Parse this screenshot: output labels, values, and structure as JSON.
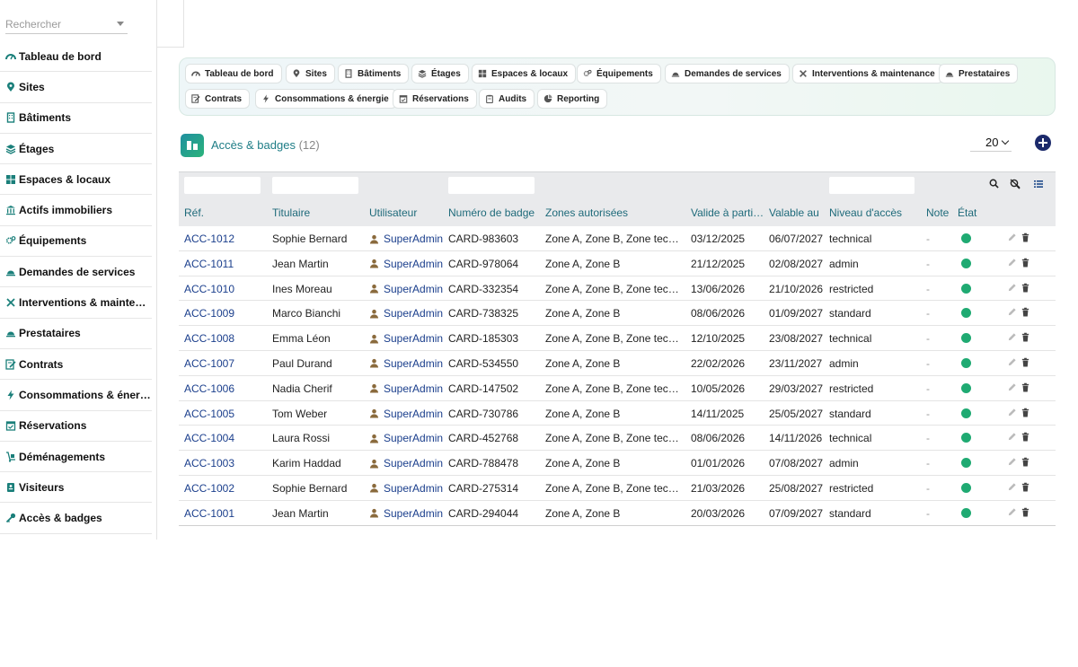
{
  "search": {
    "placeholder": "Rechercher"
  },
  "sidebar": {
    "items": [
      {
        "label": "Tableau de bord",
        "icon": "dashboard-icon"
      },
      {
        "label": "Sites",
        "icon": "map-pin-icon"
      },
      {
        "label": "Bâtiments",
        "icon": "building-icon"
      },
      {
        "label": "Étages",
        "icon": "layers-icon"
      },
      {
        "label": "Espaces & locaux",
        "icon": "grid-icon"
      },
      {
        "label": "Actifs immobiliers",
        "icon": "bank-icon"
      },
      {
        "label": "Équipements",
        "icon": "gears-icon"
      },
      {
        "label": "Demandes de services",
        "icon": "service-bell-icon"
      },
      {
        "label": "Interventions & maintenance",
        "icon": "tools-icon"
      },
      {
        "label": "Prestataires",
        "icon": "service-bell-icon"
      },
      {
        "label": "Contrats",
        "icon": "contract-icon"
      },
      {
        "label": "Consommations & énergie",
        "icon": "bolt-icon"
      },
      {
        "label": "Réservations",
        "icon": "calendar-check-icon"
      },
      {
        "label": "Déménagements",
        "icon": "dolly-icon"
      },
      {
        "label": "Visiteurs",
        "icon": "id-card-icon"
      },
      {
        "label": "Accès & badges",
        "icon": "key-icon"
      }
    ]
  },
  "modules": {
    "row1": [
      {
        "label": "Tableau de bord",
        "icon": "dashboard-icon"
      },
      {
        "label": "Sites",
        "icon": "map-pin-icon"
      },
      {
        "label": "Bâtiments",
        "icon": "building-icon"
      },
      {
        "label": "Étages",
        "icon": "layers-icon"
      },
      {
        "label": "Espaces & locaux",
        "icon": "grid-icon"
      },
      {
        "label": "Équipements",
        "icon": "gears-icon"
      },
      {
        "label": "Demandes de services",
        "icon": "service-bell-icon"
      },
      {
        "label": "Interventions & maintenance",
        "icon": "tools-icon"
      },
      {
        "label": "Prestataires",
        "icon": "service-bell-icon"
      }
    ],
    "row2": [
      {
        "label": "Contrats",
        "icon": "contract-icon"
      },
      {
        "label": "Consommations & énergie",
        "icon": "bolt-icon"
      },
      {
        "label": "Réservations",
        "icon": "calendar-check-icon"
      },
      {
        "label": "Audits",
        "icon": "clipboard-icon"
      },
      {
        "label": "Reporting",
        "icon": "pie-chart-icon"
      }
    ]
  },
  "page": {
    "title": "Accès & badges",
    "count": "(12)",
    "per_page": "20"
  },
  "table": {
    "columns": [
      "Réf.",
      "Titulaire",
      "Utilisateur",
      "Numéro de badge",
      "Zones autorisées",
      "Valide à partir du",
      "Valable au",
      "Niveau d'accès",
      "Note",
      "État"
    ],
    "rows": [
      {
        "ref": "ACC-1012",
        "holder": "Sophie Bernard",
        "user": "SuperAdmin",
        "badge": "CARD-983603",
        "zones": "Zone A, Zone B, Zone technique",
        "from": "03/12/2025",
        "to": "06/07/2027",
        "level": "technical",
        "note": "-",
        "state": "active"
      },
      {
        "ref": "ACC-1011",
        "holder": "Jean Martin",
        "user": "SuperAdmin",
        "badge": "CARD-978064",
        "zones": "Zone A, Zone B",
        "from": "21/12/2025",
        "to": "02/08/2027",
        "level": "admin",
        "note": "-",
        "state": "active"
      },
      {
        "ref": "ACC-1010",
        "holder": "Ines Moreau",
        "user": "SuperAdmin",
        "badge": "CARD-332354",
        "zones": "Zone A, Zone B, Zone technique",
        "from": "13/06/2026",
        "to": "21/10/2026",
        "level": "restricted",
        "note": "-",
        "state": "active"
      },
      {
        "ref": "ACC-1009",
        "holder": "Marco Bianchi",
        "user": "SuperAdmin",
        "badge": "CARD-738325",
        "zones": "Zone A, Zone B",
        "from": "08/06/2026",
        "to": "01/09/2027",
        "level": "standard",
        "note": "-",
        "state": "active"
      },
      {
        "ref": "ACC-1008",
        "holder": "Emma Léon",
        "user": "SuperAdmin",
        "badge": "CARD-185303",
        "zones": "Zone A, Zone B, Zone technique",
        "from": "12/10/2025",
        "to": "23/08/2027",
        "level": "technical",
        "note": "-",
        "state": "active"
      },
      {
        "ref": "ACC-1007",
        "holder": "Paul Durand",
        "user": "SuperAdmin",
        "badge": "CARD-534550",
        "zones": "Zone A, Zone B",
        "from": "22/02/2026",
        "to": "23/11/2027",
        "level": "admin",
        "note": "-",
        "state": "active"
      },
      {
        "ref": "ACC-1006",
        "holder": "Nadia Cherif",
        "user": "SuperAdmin",
        "badge": "CARD-147502",
        "zones": "Zone A, Zone B, Zone technique",
        "from": "10/05/2026",
        "to": "29/03/2027",
        "level": "restricted",
        "note": "-",
        "state": "active"
      },
      {
        "ref": "ACC-1005",
        "holder": "Tom Weber",
        "user": "SuperAdmin",
        "badge": "CARD-730786",
        "zones": "Zone A, Zone B",
        "from": "14/11/2025",
        "to": "25/05/2027",
        "level": "standard",
        "note": "-",
        "state": "active"
      },
      {
        "ref": "ACC-1004",
        "holder": "Laura Rossi",
        "user": "SuperAdmin",
        "badge": "CARD-452768",
        "zones": "Zone A, Zone B, Zone technique",
        "from": "08/06/2026",
        "to": "14/11/2026",
        "level": "technical",
        "note": "-",
        "state": "active"
      },
      {
        "ref": "ACC-1003",
        "holder": "Karim Haddad",
        "user": "SuperAdmin",
        "badge": "CARD-788478",
        "zones": "Zone A, Zone B",
        "from": "01/01/2026",
        "to": "07/08/2027",
        "level": "admin",
        "note": "-",
        "state": "active"
      },
      {
        "ref": "ACC-1002",
        "holder": "Sophie Bernard",
        "user": "SuperAdmin",
        "badge": "CARD-275314",
        "zones": "Zone A, Zone B, Zone technique",
        "from": "21/03/2026",
        "to": "25/08/2027",
        "level": "restricted",
        "note": "-",
        "state": "active"
      },
      {
        "ref": "ACC-1001",
        "holder": "Jean Martin",
        "user": "SuperAdmin",
        "badge": "CARD-294044",
        "zones": "Zone A, Zone B",
        "from": "20/03/2026",
        "to": "07/09/2027",
        "level": "standard",
        "note": "-",
        "state": "active"
      }
    ]
  },
  "colors": {
    "accent": "#1e7d86",
    "link": "#1a3e8c",
    "status_active": "#1faa72",
    "add_button": "#1c2a6b"
  }
}
